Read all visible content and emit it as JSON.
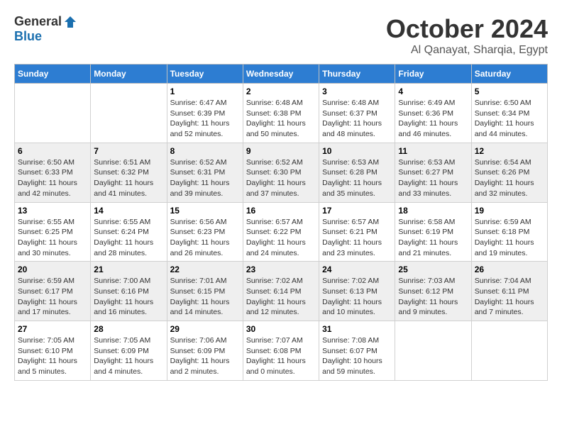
{
  "logo": {
    "general": "General",
    "blue": "Blue"
  },
  "title": "October 2024",
  "location": "Al Qanayat, Sharqia, Egypt",
  "days_of_week": [
    "Sunday",
    "Monday",
    "Tuesday",
    "Wednesday",
    "Thursday",
    "Friday",
    "Saturday"
  ],
  "weeks": [
    [
      {
        "day": "",
        "content": ""
      },
      {
        "day": "",
        "content": ""
      },
      {
        "day": "1",
        "sunrise": "Sunrise: 6:47 AM",
        "sunset": "Sunset: 6:39 PM",
        "daylight": "Daylight: 11 hours and 52 minutes."
      },
      {
        "day": "2",
        "sunrise": "Sunrise: 6:48 AM",
        "sunset": "Sunset: 6:38 PM",
        "daylight": "Daylight: 11 hours and 50 minutes."
      },
      {
        "day": "3",
        "sunrise": "Sunrise: 6:48 AM",
        "sunset": "Sunset: 6:37 PM",
        "daylight": "Daylight: 11 hours and 48 minutes."
      },
      {
        "day": "4",
        "sunrise": "Sunrise: 6:49 AM",
        "sunset": "Sunset: 6:36 PM",
        "daylight": "Daylight: 11 hours and 46 minutes."
      },
      {
        "day": "5",
        "sunrise": "Sunrise: 6:50 AM",
        "sunset": "Sunset: 6:34 PM",
        "daylight": "Daylight: 11 hours and 44 minutes."
      }
    ],
    [
      {
        "day": "6",
        "sunrise": "Sunrise: 6:50 AM",
        "sunset": "Sunset: 6:33 PM",
        "daylight": "Daylight: 11 hours and 42 minutes."
      },
      {
        "day": "7",
        "sunrise": "Sunrise: 6:51 AM",
        "sunset": "Sunset: 6:32 PM",
        "daylight": "Daylight: 11 hours and 41 minutes."
      },
      {
        "day": "8",
        "sunrise": "Sunrise: 6:52 AM",
        "sunset": "Sunset: 6:31 PM",
        "daylight": "Daylight: 11 hours and 39 minutes."
      },
      {
        "day": "9",
        "sunrise": "Sunrise: 6:52 AM",
        "sunset": "Sunset: 6:30 PM",
        "daylight": "Daylight: 11 hours and 37 minutes."
      },
      {
        "day": "10",
        "sunrise": "Sunrise: 6:53 AM",
        "sunset": "Sunset: 6:28 PM",
        "daylight": "Daylight: 11 hours and 35 minutes."
      },
      {
        "day": "11",
        "sunrise": "Sunrise: 6:53 AM",
        "sunset": "Sunset: 6:27 PM",
        "daylight": "Daylight: 11 hours and 33 minutes."
      },
      {
        "day": "12",
        "sunrise": "Sunrise: 6:54 AM",
        "sunset": "Sunset: 6:26 PM",
        "daylight": "Daylight: 11 hours and 32 minutes."
      }
    ],
    [
      {
        "day": "13",
        "sunrise": "Sunrise: 6:55 AM",
        "sunset": "Sunset: 6:25 PM",
        "daylight": "Daylight: 11 hours and 30 minutes."
      },
      {
        "day": "14",
        "sunrise": "Sunrise: 6:55 AM",
        "sunset": "Sunset: 6:24 PM",
        "daylight": "Daylight: 11 hours and 28 minutes."
      },
      {
        "day": "15",
        "sunrise": "Sunrise: 6:56 AM",
        "sunset": "Sunset: 6:23 PM",
        "daylight": "Daylight: 11 hours and 26 minutes."
      },
      {
        "day": "16",
        "sunrise": "Sunrise: 6:57 AM",
        "sunset": "Sunset: 6:22 PM",
        "daylight": "Daylight: 11 hours and 24 minutes."
      },
      {
        "day": "17",
        "sunrise": "Sunrise: 6:57 AM",
        "sunset": "Sunset: 6:21 PM",
        "daylight": "Daylight: 11 hours and 23 minutes."
      },
      {
        "day": "18",
        "sunrise": "Sunrise: 6:58 AM",
        "sunset": "Sunset: 6:19 PM",
        "daylight": "Daylight: 11 hours and 21 minutes."
      },
      {
        "day": "19",
        "sunrise": "Sunrise: 6:59 AM",
        "sunset": "Sunset: 6:18 PM",
        "daylight": "Daylight: 11 hours and 19 minutes."
      }
    ],
    [
      {
        "day": "20",
        "sunrise": "Sunrise: 6:59 AM",
        "sunset": "Sunset: 6:17 PM",
        "daylight": "Daylight: 11 hours and 17 minutes."
      },
      {
        "day": "21",
        "sunrise": "Sunrise: 7:00 AM",
        "sunset": "Sunset: 6:16 PM",
        "daylight": "Daylight: 11 hours and 16 minutes."
      },
      {
        "day": "22",
        "sunrise": "Sunrise: 7:01 AM",
        "sunset": "Sunset: 6:15 PM",
        "daylight": "Daylight: 11 hours and 14 minutes."
      },
      {
        "day": "23",
        "sunrise": "Sunrise: 7:02 AM",
        "sunset": "Sunset: 6:14 PM",
        "daylight": "Daylight: 11 hours and 12 minutes."
      },
      {
        "day": "24",
        "sunrise": "Sunrise: 7:02 AM",
        "sunset": "Sunset: 6:13 PM",
        "daylight": "Daylight: 11 hours and 10 minutes."
      },
      {
        "day": "25",
        "sunrise": "Sunrise: 7:03 AM",
        "sunset": "Sunset: 6:12 PM",
        "daylight": "Daylight: 11 hours and 9 minutes."
      },
      {
        "day": "26",
        "sunrise": "Sunrise: 7:04 AM",
        "sunset": "Sunset: 6:11 PM",
        "daylight": "Daylight: 11 hours and 7 minutes."
      }
    ],
    [
      {
        "day": "27",
        "sunrise": "Sunrise: 7:05 AM",
        "sunset": "Sunset: 6:10 PM",
        "daylight": "Daylight: 11 hours and 5 minutes."
      },
      {
        "day": "28",
        "sunrise": "Sunrise: 7:05 AM",
        "sunset": "Sunset: 6:09 PM",
        "daylight": "Daylight: 11 hours and 4 minutes."
      },
      {
        "day": "29",
        "sunrise": "Sunrise: 7:06 AM",
        "sunset": "Sunset: 6:09 PM",
        "daylight": "Daylight: 11 hours and 2 minutes."
      },
      {
        "day": "30",
        "sunrise": "Sunrise: 7:07 AM",
        "sunset": "Sunset: 6:08 PM",
        "daylight": "Daylight: 11 hours and 0 minutes."
      },
      {
        "day": "31",
        "sunrise": "Sunrise: 7:08 AM",
        "sunset": "Sunset: 6:07 PM",
        "daylight": "Daylight: 10 hours and 59 minutes."
      },
      {
        "day": "",
        "content": ""
      },
      {
        "day": "",
        "content": ""
      }
    ]
  ]
}
